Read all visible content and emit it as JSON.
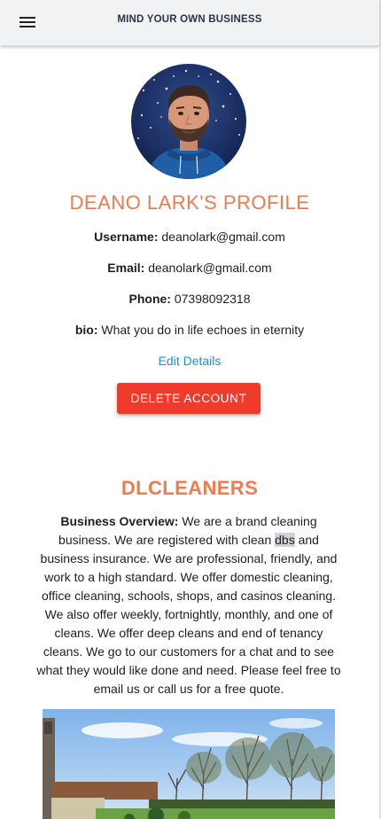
{
  "appbar": {
    "title": "MIND YOUR OWN BUSINESS",
    "menu_icon": "hamburger-menu-icon"
  },
  "profile": {
    "title": "DEANO LARK'S PROFILE",
    "username_label": "Username:",
    "username": "deanolark@gmail.com",
    "email_label": "Email:",
    "email": "deanolark@gmail.com",
    "phone_label": "Phone:",
    "phone": "07398092318",
    "bio_label": "bio:",
    "bio": "What you do in life echoes in eternity",
    "edit_label": "Edit Details",
    "delete_label": "DELETE ACCOUNT"
  },
  "business": {
    "name": "DLCLEANERS",
    "overview_label": "Business Overview:",
    "overview_part1": "We are a brand cleaning business. We are registered with clean",
    "overview_highlight": "dbs",
    "overview_part2": "and business insurance. We are professional, friendly, and work to a high standard. We offer domestic cleaning, office cleaning, schools, shops, and casinos cleaning. We also offer weekly, fortnightly, monthly, and one of cleans. We offer deep cleans and end of tenancy cleans. We go to our customers for a chat and to see what they would like done and need. Please feel free to email us or call us for a free quote."
  },
  "colors": {
    "accent": "#f07b4e",
    "link": "#1e8fd6",
    "danger": "#ef3b2c",
    "appbar": "#f0f2f4"
  }
}
